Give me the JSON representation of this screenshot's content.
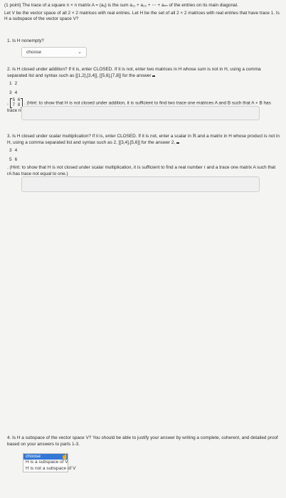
{
  "intro": {
    "line1": "(1 point) The trace of a square n × n matrix A = (aᵢⱼ) is the sum a₁₁ + a₂₂ + ⋯ + aₙₙ of the entries on its main diagonal.",
    "line2": "Let V be the vector space of all 2 × 2 matrices with real entries. Let H be the set of all 2 × 2 matrices with real entries that have trace 1. Is H a subspace of the vector space V?"
  },
  "q1": {
    "text": "1. Is H nonempty?",
    "select_value": "choose",
    "chevron_icon": "chevron-down"
  },
  "q2": {
    "text_a": "2. Is H closed under addition? If it is, enter CLOSED. If it is not, enter two matrices in H whose sum is not in H, using a comma separated list and syntax such as [[1,2],[3,4]], [[5,6],[7,8]] for the answer",
    "matrix1": [
      [
        "1",
        "2"
      ],
      [
        "3",
        "4"
      ]
    ],
    "sep": ",",
    "matrix2": [
      [
        "5",
        "6"
      ],
      [
        "7",
        "8"
      ]
    ],
    "text_b": ". (Hint: to show that H is not closed under addition, it is sufficient to find two trace one matrices A and B such that A + B has trace not equal to one.)",
    "input_value": ""
  },
  "q3": {
    "text_a": "3. Is H closed under scalar multiplication? If it is, enter CLOSED. If it is not, enter a scalar in ℝ and a matrix in H whose product is not in H, using a comma separated list and syntax such as 2, [[3,4],[5,6]] for the answer 2,",
    "matrix": [
      [
        "3",
        "4"
      ],
      [
        "5",
        "6"
      ]
    ],
    "text_b": ". (Hint: to show that H is not closed under scalar multiplication, it is sufficient to find a real number r and a trace one matrix A such that rA has trace not equal to one.)",
    "input_value": ""
  },
  "q4": {
    "text": "4. Is H a subspace of the vector space V? You should be able to justify your answer by writing a complete, coherent, and detailed proof based on your answers to parts 1-3.",
    "options": [
      "choose",
      "H is a subspace of V",
      "H is not a subspace of V"
    ],
    "selected_index": 0
  },
  "colors": {
    "highlight": "#3477d6",
    "page_bg": "#f4f4f2"
  }
}
